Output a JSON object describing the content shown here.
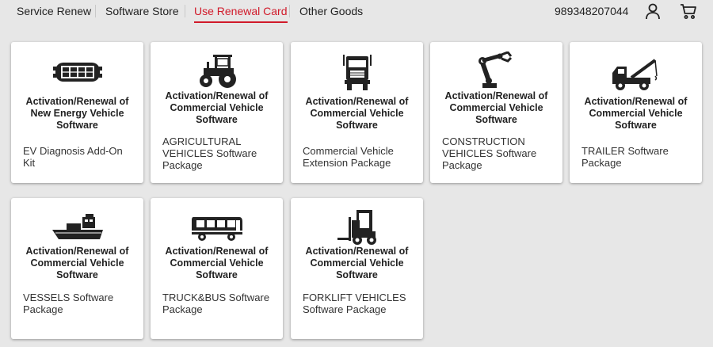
{
  "header": {
    "tabs": [
      {
        "label": "Service Renew",
        "active": false
      },
      {
        "label": "Software Store",
        "active": false
      },
      {
        "label": "Use Renewal Card",
        "active": true
      },
      {
        "label": "Other Goods",
        "active": false
      }
    ],
    "phone": "989348207044",
    "accent_color": "#d11a2a",
    "user_icon": "user-icon",
    "cart_icon": "cart-icon"
  },
  "cards": [
    {
      "icon": "ev-car-icon",
      "title": "Activation/Renewal of New Energy Vehicle Software",
      "desc": "EV Diagnosis Add-On Kit"
    },
    {
      "icon": "tractor-icon",
      "title": "Activation/Renewal of Commercial Vehicle Software",
      "desc": "AGRICULTURAL VEHICLES Software Package"
    },
    {
      "icon": "truck-front-icon",
      "title": "Activation/Renewal of Commercial Vehicle Software",
      "desc": "Commercial Vehicle Extension Package"
    },
    {
      "icon": "robot-arm-icon",
      "title": "Activation/Renewal of Commercial Vehicle Software",
      "desc": "CONSTRUCTION VEHICLES Software Package"
    },
    {
      "icon": "tow-truck-icon",
      "title": "Activation/Renewal of Commercial Vehicle Software",
      "desc": "TRAILER Software Package"
    },
    {
      "icon": "ship-icon",
      "title": "Activation/Renewal of Commercial Vehicle Software",
      "desc": "VESSELS Software Package"
    },
    {
      "icon": "bus-icon",
      "title": "Activation/Renewal of Commercial Vehicle Software",
      "desc": "TRUCK&BUS Software Package"
    },
    {
      "icon": "forklift-icon",
      "title": "Activation/Renewal of Commercial Vehicle Software",
      "desc": "FORKLIFT VEHICLES Software Package"
    }
  ]
}
